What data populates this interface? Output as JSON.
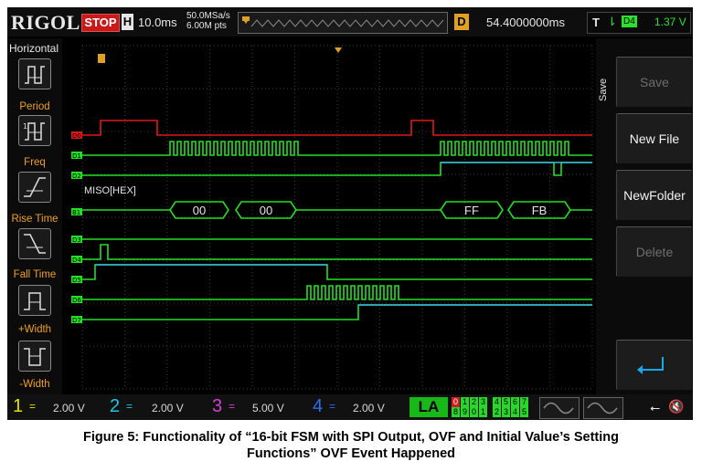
{
  "topbar": {
    "brand": "RIGOL",
    "run_state": "STOP",
    "timebase_badge": "H",
    "timebase": "10.0ms",
    "sample_rate": "50.0MSa/s",
    "memory_depth": "6.00M pts",
    "delay_badge": "D",
    "delay": "54.4000000ms",
    "trigger_label": "T",
    "trigger_edge": "⇂",
    "trigger_source": "D4",
    "trigger_level": "1.37 V",
    "colors": {
      "stop": "#c81a1a",
      "delay_badge": "#e0a020",
      "trigger": "#2ee02e"
    }
  },
  "left_panel": {
    "title": "Horizontal",
    "buttons": [
      {
        "label": "Period",
        "icon": "period-icon"
      },
      {
        "label": "Freq",
        "icon": "freq-icon"
      },
      {
        "label": "Rise Time",
        "icon": "rise-time-icon"
      },
      {
        "label": "Fall Time",
        "icon": "fall-time-icon"
      },
      {
        "label": "+Width",
        "icon": "positive-width-icon"
      },
      {
        "label": "-Width",
        "icon": "negative-width-icon"
      }
    ],
    "label_color": "#f0a020"
  },
  "right_panel": {
    "tab": "Save",
    "buttons": [
      {
        "label": "Save",
        "enabled": false
      },
      {
        "label": "New File",
        "enabled": true
      },
      {
        "label": "NewFolder",
        "enabled": true
      },
      {
        "label": "Delete",
        "enabled": false
      },
      {
        "label": "",
        "icon": "enter-icon",
        "enabled": true
      }
    ]
  },
  "screen": {
    "bus_label": "MISO[HEX]",
    "channels": [
      {
        "tag": "D0",
        "color": "#e01818"
      },
      {
        "tag": "D1",
        "color": "#22e022"
      },
      {
        "tag": "D2",
        "color": "#22e022"
      },
      {
        "tag": "B1",
        "color": "#22e022"
      },
      {
        "tag": "D3",
        "color": "#22e022"
      },
      {
        "tag": "D4",
        "color": "#22e022"
      },
      {
        "tag": "D5",
        "color": "#22e022"
      },
      {
        "tag": "D6",
        "color": "#22e022"
      },
      {
        "tag": "D7",
        "color": "#22e022"
      }
    ],
    "bus_values": [
      "00",
      "00",
      "FF",
      "FB"
    ],
    "trace_color": "#22e022",
    "high_color": "#38b6e6",
    "d0_color": "#e01818"
  },
  "bottom_bar": {
    "channels": [
      {
        "num": "1",
        "coupling": "=",
        "scale": "2.00 V",
        "color": "#e8e000"
      },
      {
        "num": "2",
        "coupling": "=",
        "scale": "2.00 V",
        "color": "#18c8e8"
      },
      {
        "num": "3",
        "coupling": "=",
        "scale": "5.00 V",
        "color": "#d040d0"
      },
      {
        "num": "4",
        "coupling": "=",
        "scale": "2.00 V",
        "color": "#2870e8"
      }
    ],
    "la_label": "LA",
    "la_row1": [
      "0",
      "1",
      "2",
      "3",
      " ",
      "4",
      "5",
      "6",
      "7"
    ],
    "la_row2": [
      "8",
      "9",
      "0",
      "1",
      " ",
      "2",
      "3",
      "4",
      "5"
    ],
    "la_color": "#18b818"
  },
  "caption": {
    "line1": "Figure 5: Functionality of “16-bit FSM with SPI Output, OVF and Initial Value’s Setting",
    "line2": "Functions” OVF Event Happened"
  }
}
